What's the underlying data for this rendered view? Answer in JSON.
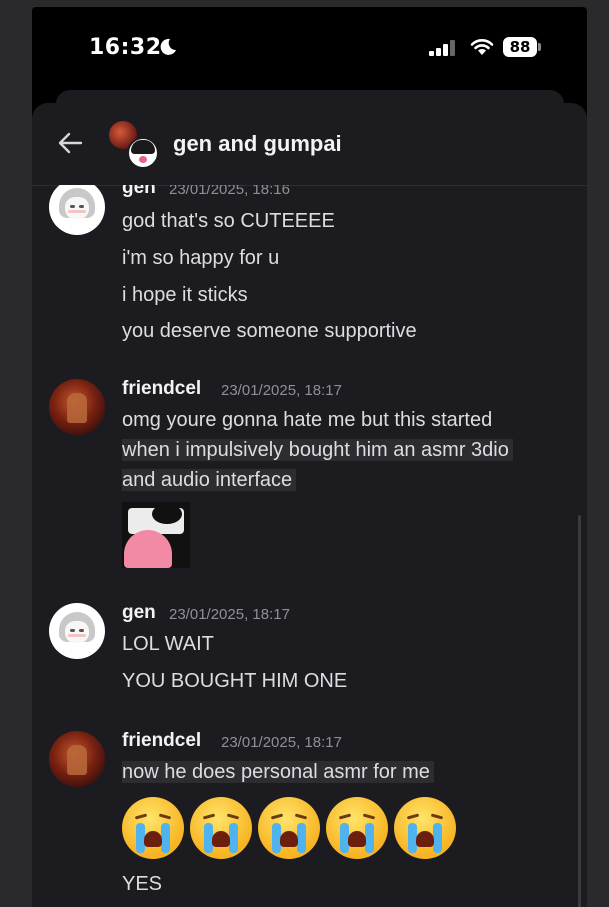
{
  "status": {
    "time": "16:32",
    "battery": "88"
  },
  "chat": {
    "title": "gen and gumpai"
  },
  "messages": [
    {
      "author": "gen",
      "timestamp": "23/01/2025, 18:16",
      "lines": [
        "god that's so CUTEEEE",
        "i'm so happy for u",
        "i hope it sticks",
        "you deserve someone supportive"
      ]
    },
    {
      "author": "friendcel",
      "timestamp": "23/01/2025, 18:17",
      "lines": [
        "omg youre gonna hate me but this started",
        "when i impulsively bought him an asmr 3dio",
        "and audio interface"
      ]
    },
    {
      "author": "gen",
      "timestamp": "23/01/2025, 18:17",
      "lines": [
        "LOL WAIT",
        "YOU BOUGHT HIM ONE"
      ]
    },
    {
      "author": "friendcel",
      "timestamp": "23/01/2025, 18:17",
      "lines": [
        "now he does personal asmr for me",
        "YES"
      ]
    }
  ],
  "emoji_reaction": "loudly-crying-face"
}
